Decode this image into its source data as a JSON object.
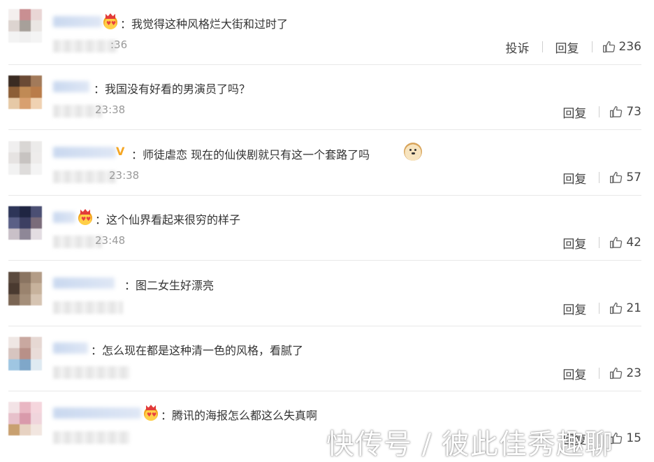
{
  "comments": [
    {
      "text": "：我觉得这种风格烂大街和过时了",
      "time_visible": ":36",
      "report_label": "投诉",
      "reply_label": "回复",
      "likes": "236",
      "avatar_colors": [
        "#f4efee",
        "#c98f92",
        "#e9d6d5",
        "#ddd4d0",
        "#a7a09a",
        "#eae6e3",
        "#f3f3f3",
        "#f0f0f0",
        "#f4f4f4"
      ]
    },
    {
      "text": "：我国没有好看的男演员了吗？",
      "time_visible": "23:38",
      "reply_label": "回复",
      "likes": "73",
      "avatar_colors": [
        "#3a2b22",
        "#6b4a35",
        "#a27a5a",
        "#8c5e36",
        "#c08a55",
        "#b97c4a",
        "#e6c9a6",
        "#d8a070",
        "#f0d2b2"
      ]
    },
    {
      "text": "：师徒虐恋 现在的仙侠剧就只有这一个套路了吗",
      "time_visible": "23:38",
      "reply_label": "回复",
      "likes": "57",
      "avatar_colors": [
        "#f0efef",
        "#d9d6d4",
        "#ecebea",
        "#e6e3e2",
        "#c7c3c1",
        "#eeeceb",
        "#f2f2f2",
        "#dedcdb",
        "#f4f4f4"
      ]
    },
    {
      "text": "：这个仙界看起来很穷的样子",
      "time_visible": "23:48",
      "reply_label": "回复",
      "likes": "42",
      "avatar_colors": [
        "#2d3558",
        "#1f2542",
        "#4b4f73",
        "#5a5f86",
        "#3c3f62",
        "#7a6c7a",
        "#c9c0c8",
        "#8e8797",
        "#e3dde2"
      ]
    },
    {
      "text": "：图二女生好漂亮",
      "time_visible": "",
      "reply_label": "回复",
      "likes": "21",
      "avatar_colors": [
        "#5b4a3e",
        "#8a7461",
        "#b39c86",
        "#4a3a30",
        "#9a836e",
        "#c7b29c",
        "#7a6553",
        "#a58f7a",
        "#d6c4b2"
      ]
    },
    {
      "text": "：怎么现在都是这种清一色的风格，看腻了",
      "time_visible": "",
      "reply_label": "回复",
      "likes": "23",
      "avatar_colors": [
        "#efe7e4",
        "#c9a8a0",
        "#e6d8d3",
        "#d7c5c0",
        "#b89088",
        "#e9dcd8",
        "#9fc6e2",
        "#7fa7c9",
        "#dfeaf2"
      ]
    },
    {
      "text": "：腾讯的海报怎么都这么失真啊",
      "time_visible": "",
      "reply_label": "回复",
      "likes": "15",
      "avatar_colors": [
        "#f3e3e6",
        "#e9b7c3",
        "#f5d6dd",
        "#e7c1cb",
        "#d99aab",
        "#f0d5dc",
        "#c8a070",
        "#e7d2c2",
        "#f2e6e0"
      ]
    }
  ],
  "watermark": "快传号 / 彼此佳秀趣聊"
}
